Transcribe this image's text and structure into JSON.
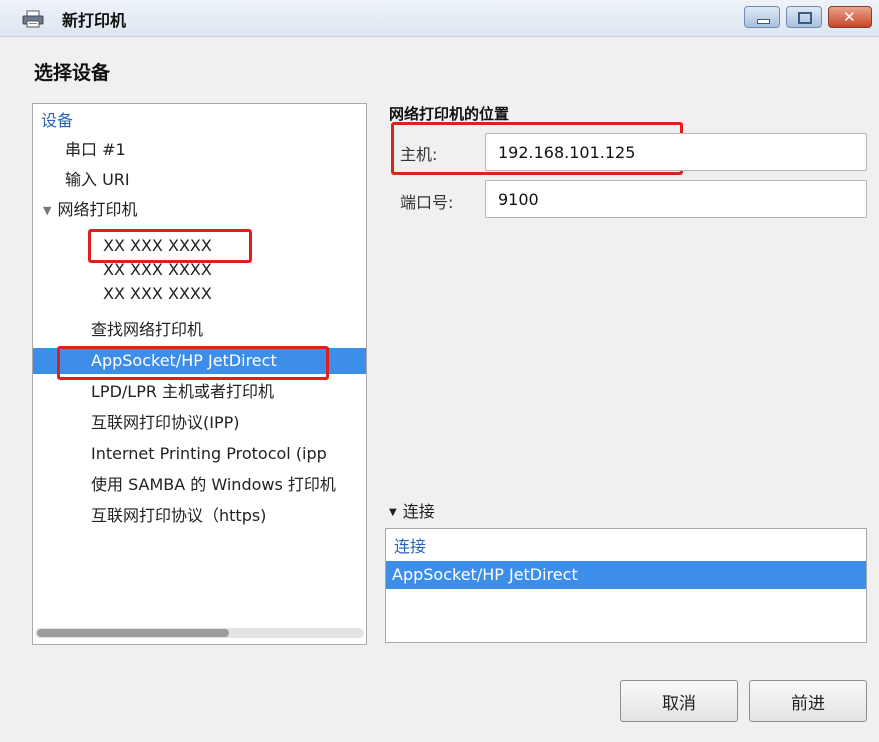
{
  "window": {
    "title": "新打印机",
    "controls": {
      "minimize": "minimize",
      "maximize": "maximize",
      "close": "close"
    }
  },
  "page": {
    "heading": "选择设备"
  },
  "device_tree": {
    "header": "设备",
    "items": [
      {
        "label": "串口 #1",
        "level": 0
      },
      {
        "label": "输入 URI",
        "level": 0
      },
      {
        "label": "网络打印机",
        "level": 0,
        "expanded": true
      },
      {
        "label": "XX XXX XXXX",
        "level": 1
      },
      {
        "label": "XX XXX XXXX",
        "level": 1
      },
      {
        "label": "XX XXX XXXX",
        "level": 1
      },
      {
        "label": "查找网络打印机",
        "level": 1
      },
      {
        "label": "AppSocket/HP JetDirect",
        "level": 1,
        "selected": true
      },
      {
        "label": "LPD/LPR 主机或者打印机",
        "level": 1
      },
      {
        "label": "互联网打印协议(IPP)",
        "level": 1
      },
      {
        "label": "Internet Printing Protocol (ipp",
        "level": 1
      },
      {
        "label": "使用 SAMBA 的 Windows 打印机",
        "level": 1
      },
      {
        "label": "互联网打印协议（https)",
        "level": 1
      }
    ]
  },
  "location": {
    "section_title": "网络打印机的位置",
    "host_label": "主机:",
    "host_value": "192.168.101.125",
    "port_label": "端口号:",
    "port_value": "9100"
  },
  "connection": {
    "toggle_label": "连接",
    "list_header": "连接",
    "selected_item": "AppSocket/HP JetDirect"
  },
  "buttons": {
    "cancel": "取消",
    "forward": "前进"
  },
  "colors": {
    "selection": "#3d8ee8",
    "highlight_box": "#e01f1f",
    "header_blue": "#2a64b8"
  }
}
